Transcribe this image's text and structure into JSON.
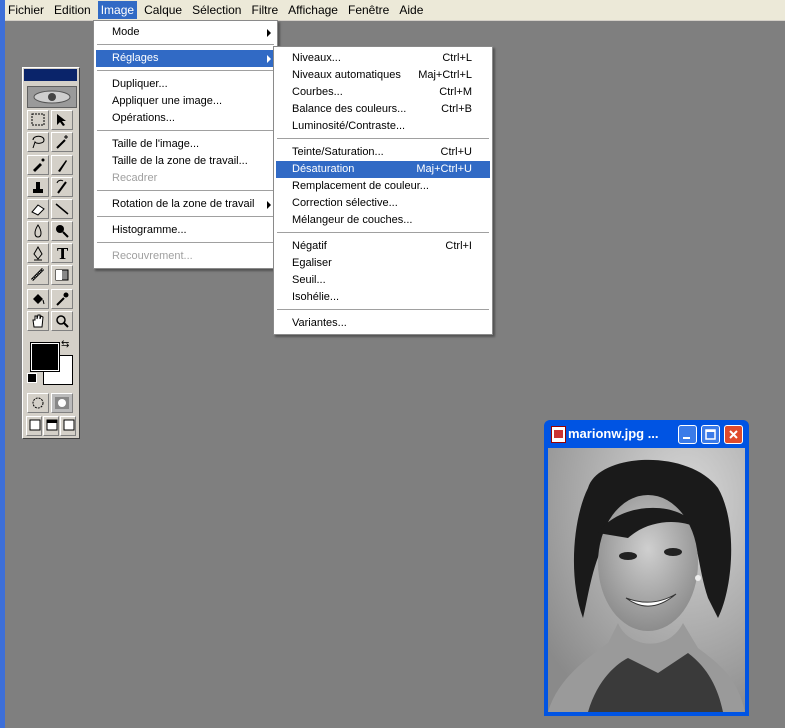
{
  "menubar": {
    "items": [
      "Fichier",
      "Edition",
      "Image",
      "Calque",
      "Sélection",
      "Filtre",
      "Affichage",
      "Fenêtre",
      "Aide"
    ],
    "active_index": 2
  },
  "image_menu": {
    "items": [
      {
        "label": "Mode",
        "shortcut": "",
        "submenu": true,
        "disabled": false
      },
      {
        "label": "Réglages",
        "shortcut": "",
        "submenu": true,
        "disabled": false
      },
      {
        "label": "Dupliquer...",
        "shortcut": "",
        "submenu": false,
        "disabled": false
      },
      {
        "label": "Appliquer une image...",
        "shortcut": "",
        "submenu": false,
        "disabled": false
      },
      {
        "label": "Opérations...",
        "shortcut": "",
        "submenu": false,
        "disabled": false
      },
      {
        "label": "Taille de l'image...",
        "shortcut": "",
        "submenu": false,
        "disabled": false
      },
      {
        "label": "Taille de la zone de travail...",
        "shortcut": "",
        "submenu": false,
        "disabled": false
      },
      {
        "label": "Recadrer",
        "shortcut": "",
        "submenu": false,
        "disabled": true
      },
      {
        "label": "Rotation de la zone de travail",
        "shortcut": "",
        "submenu": true,
        "disabled": false
      },
      {
        "label": "Histogramme...",
        "shortcut": "",
        "submenu": false,
        "disabled": false
      },
      {
        "label": "Recouvrement...",
        "shortcut": "",
        "submenu": false,
        "disabled": true
      }
    ]
  },
  "reglages_menu": {
    "items": [
      {
        "label": "Niveaux...",
        "shortcut": "Ctrl+L"
      },
      {
        "label": "Niveaux automatiques",
        "shortcut": "Maj+Ctrl+L"
      },
      {
        "label": "Courbes...",
        "shortcut": "Ctrl+M"
      },
      {
        "label": "Balance des couleurs...",
        "shortcut": "Ctrl+B"
      },
      {
        "label": "Luminosité/Contraste...",
        "shortcut": ""
      },
      {
        "label": "Teinte/Saturation...",
        "shortcut": "Ctrl+U"
      },
      {
        "label": "Désaturation",
        "shortcut": "Maj+Ctrl+U"
      },
      {
        "label": "Remplacement de couleur...",
        "shortcut": ""
      },
      {
        "label": "Correction sélective...",
        "shortcut": ""
      },
      {
        "label": "Mélangeur de couches...",
        "shortcut": ""
      },
      {
        "label": "Négatif",
        "shortcut": "Ctrl+I"
      },
      {
        "label": "Egaliser",
        "shortcut": ""
      },
      {
        "label": "Seuil...",
        "shortcut": ""
      },
      {
        "label": "Isohélie...",
        "shortcut": ""
      },
      {
        "label": "Variantes...",
        "shortcut": ""
      }
    ],
    "selected_index": 6
  },
  "toolbox": {
    "tools": [
      "marquee",
      "move",
      "lasso",
      "magic-wand",
      "airbrush",
      "brush",
      "stamp",
      "history-brush",
      "eraser",
      "line",
      "blur",
      "dodge",
      "pen",
      "type",
      "measure",
      "gradient",
      "paint-bucket",
      "eyedropper",
      "hand",
      "zoom"
    ],
    "foreground_color": "#000000",
    "background_color": "#ffffff"
  },
  "image_window": {
    "title": "marionw.jpg ..."
  },
  "colors": {
    "accent": "#316ac5",
    "xp_title": "#0054e3",
    "close": "#e04b2c"
  }
}
